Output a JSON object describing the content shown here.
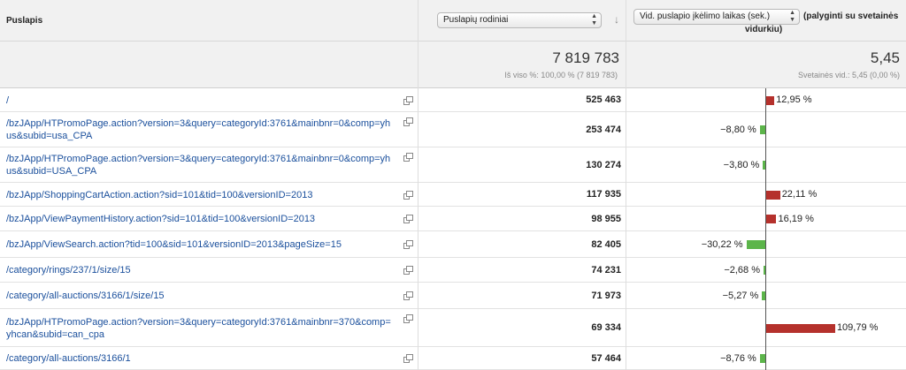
{
  "header": {
    "page_col": "Puslapis",
    "metric1_select": "Puslapių rodiniai",
    "metric2_select": "Vid. puslapio įkėlimo laikas (sek.)",
    "compare_line1": "(palyginti su svetainės",
    "compare_line2": "vidurkiu)",
    "sort_arrow": "↓"
  },
  "totals": {
    "views": "7 819 783",
    "views_sub": "Iš viso %: 100,00 % (7 819 783)",
    "load": "5,45",
    "load_sub": "Svetainės vid.: 5,45 (0,00 %)"
  },
  "colors": {
    "positive_bar": "#b5312c",
    "negative_bar": "#5cb54a",
    "link": "#1a4f9c"
  },
  "rows": [
    {
      "page": "/",
      "views": "525 463",
      "pct": "12,95 %",
      "delta": 12.95
    },
    {
      "page": "/bzJApp/HTPromoPage.action?version=3&query=categoryId:3761&mainbnr=0&comp=yhus&subid=usa_CPA",
      "views": "253 474",
      "pct": "−8,80 %",
      "delta": -8.8
    },
    {
      "page": "/bzJApp/HTPromoPage.action?version=3&query=categoryId:3761&mainbnr=0&comp=yhus&subid=USA_CPA",
      "views": "130 274",
      "pct": "−3,80 %",
      "delta": -3.8
    },
    {
      "page": "/bzJApp/ShoppingCartAction.action?sid=101&tid=100&versionID=2013",
      "views": "117 935",
      "pct": "22,11 %",
      "delta": 22.11
    },
    {
      "page": "/bzJApp/ViewPaymentHistory.action?sid=101&tid=100&versionID=2013",
      "views": "98 955",
      "pct": "16,19 %",
      "delta": 16.19
    },
    {
      "page": "/bzJApp/ViewSearch.action?tid=100&sid=101&versionID=2013&pageSize=15",
      "views": "82 405",
      "pct": "−30,22 %",
      "delta": -30.22
    },
    {
      "page": "/category/rings/237/1/size/15",
      "views": "74 231",
      "pct": "−2,68 %",
      "delta": -2.68
    },
    {
      "page": "/category/all-auctions/3166/1/size/15",
      "views": "71 973",
      "pct": "−5,27 %",
      "delta": -5.27
    },
    {
      "page": "/bzJApp/HTPromoPage.action?version=3&query=categoryId:3761&mainbnr=370&comp=yhcan&subid=can_cpa",
      "views": "69 334",
      "pct": "109,79 %",
      "delta": 109.79
    },
    {
      "page": "/category/all-auctions/3166/1",
      "views": "57 464",
      "pct": "−8,76 %",
      "delta": -8.76
    }
  ]
}
